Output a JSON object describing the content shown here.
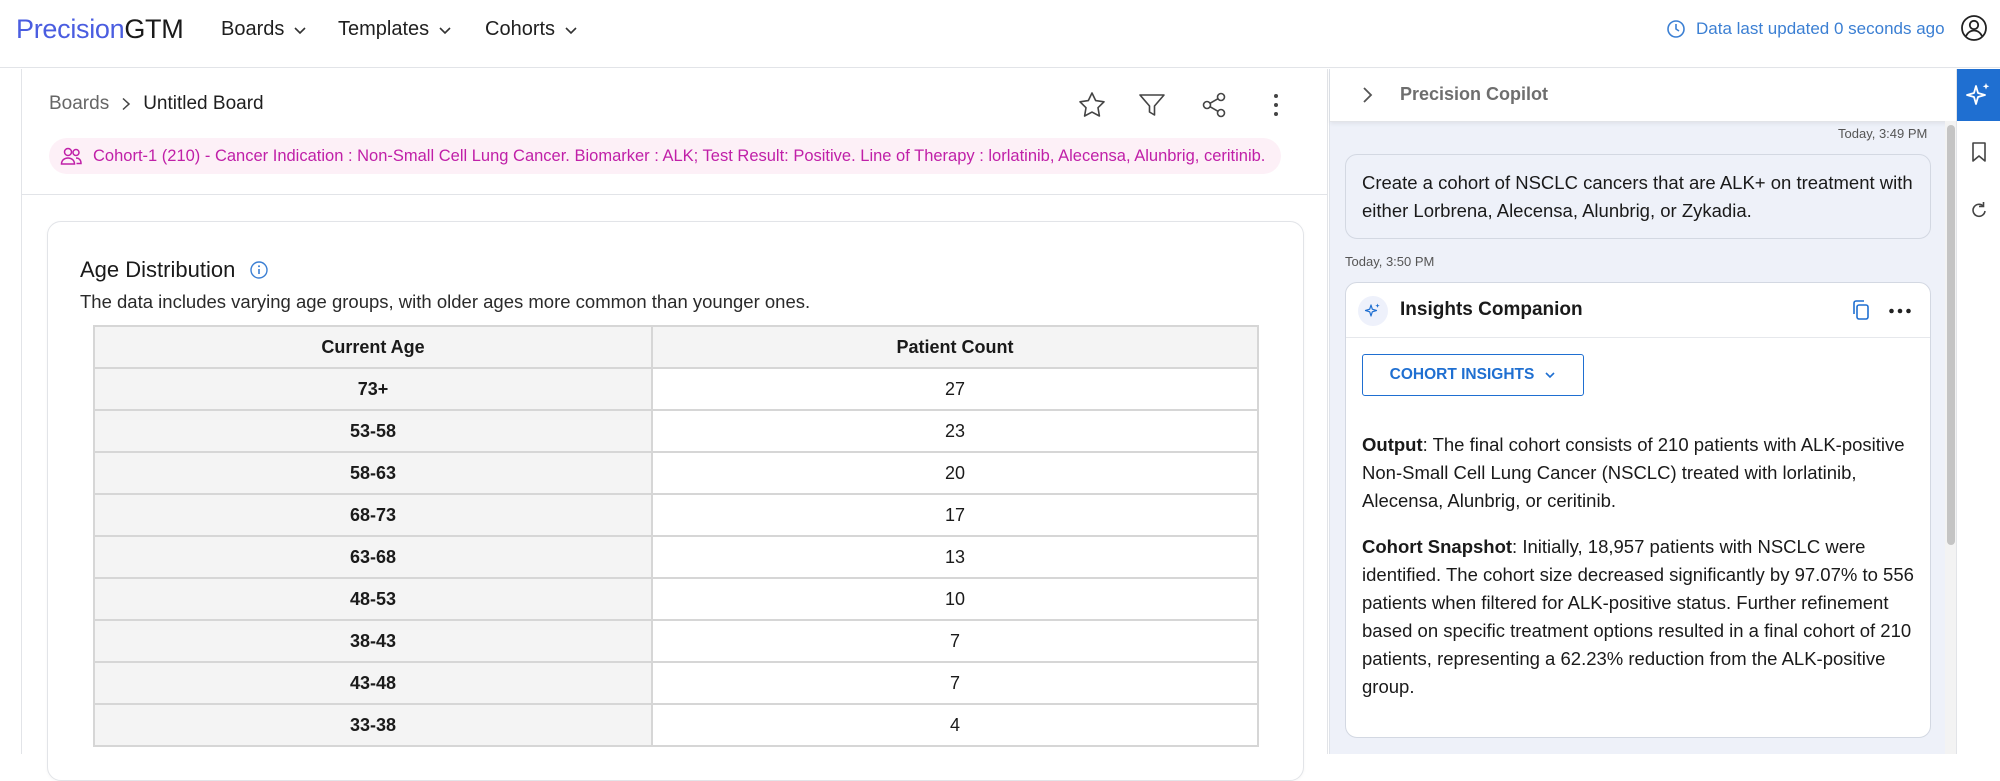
{
  "app": {
    "logo_part1": "Precision",
    "logo_part2": "GTM"
  },
  "nav": {
    "items": [
      {
        "label": "Boards"
      },
      {
        "label": "Templates"
      },
      {
        "label": "Cohorts"
      }
    ],
    "updated_text": "Data last updated 0 seconds ago"
  },
  "board": {
    "breadcrumb_root": "Boards",
    "breadcrumb_current": "Untitled Board",
    "cohort_pill": "Cohort-1 (210) - Cancer Indication : Non-Small Cell Lung Cancer. Biomarker : ALK; Test Result: Positive. Line of Therapy : lorlatinib, Alecensa, Alunbrig, ceritinib."
  },
  "card": {
    "title": "Age Distribution",
    "description": "The data includes varying age groups, with older ages more common than younger ones.",
    "columns": [
      "Current Age",
      "Patient Count"
    ],
    "rows": [
      {
        "age": "73+",
        "count": "27"
      },
      {
        "age": "53-58",
        "count": "23"
      },
      {
        "age": "58-63",
        "count": "20"
      },
      {
        "age": "68-73",
        "count": "17"
      },
      {
        "age": "63-68",
        "count": "13"
      },
      {
        "age": "48-53",
        "count": "10"
      },
      {
        "age": "38-43",
        "count": "7"
      },
      {
        "age": "43-48",
        "count": "7"
      },
      {
        "age": "33-38",
        "count": "4"
      }
    ]
  },
  "copilot": {
    "title": "Precision Copilot",
    "user_timestamp": "Today, 3:49 PM",
    "user_message": "Create a cohort of NSCLC cancers that are ALK+ on treatment with either Lorbrena, Alecensa, Alunbrig, or Zykadia.",
    "reply_timestamp": "Today, 3:50 PM",
    "reply_title": "Insights Companion",
    "insights_button": "COHORT INSIGHTS",
    "output_label": "Output",
    "output_text": ": The final cohort consists of 210 patients with ALK-positive Non-Small Cell Lung Cancer (NSCLC) treated with lorlatinib, Alecensa, Alunbrig, or ceritinib.",
    "snapshot_label": "Cohort Snapshot",
    "snapshot_text": ": Initially, 18,957 patients with NSCLC were identified. The cohort size decreased significantly by 97.07% to 556 patients when filtered for ALK-positive status. Further refinement based on specific treatment options resulted in a final cohort of 210 patients, representing a 62.23% reduction from the ALK-positive group."
  },
  "colors": {
    "brand": "#4a5de0",
    "accent": "#1f6fd1",
    "cohort_pill_text": "#c020a8",
    "cohort_pill_bg": "#fdf0f7"
  },
  "icons": [
    "chevron-down-icon",
    "clock-icon",
    "user-circle-icon",
    "chevron-right-icon",
    "star-icon",
    "filter-icon",
    "share-icon",
    "more-vertical-icon",
    "users-icon",
    "info-icon",
    "sparkle-icon",
    "copy-icon",
    "more-horizontal-icon",
    "bookmark-icon",
    "refresh-icon"
  ]
}
